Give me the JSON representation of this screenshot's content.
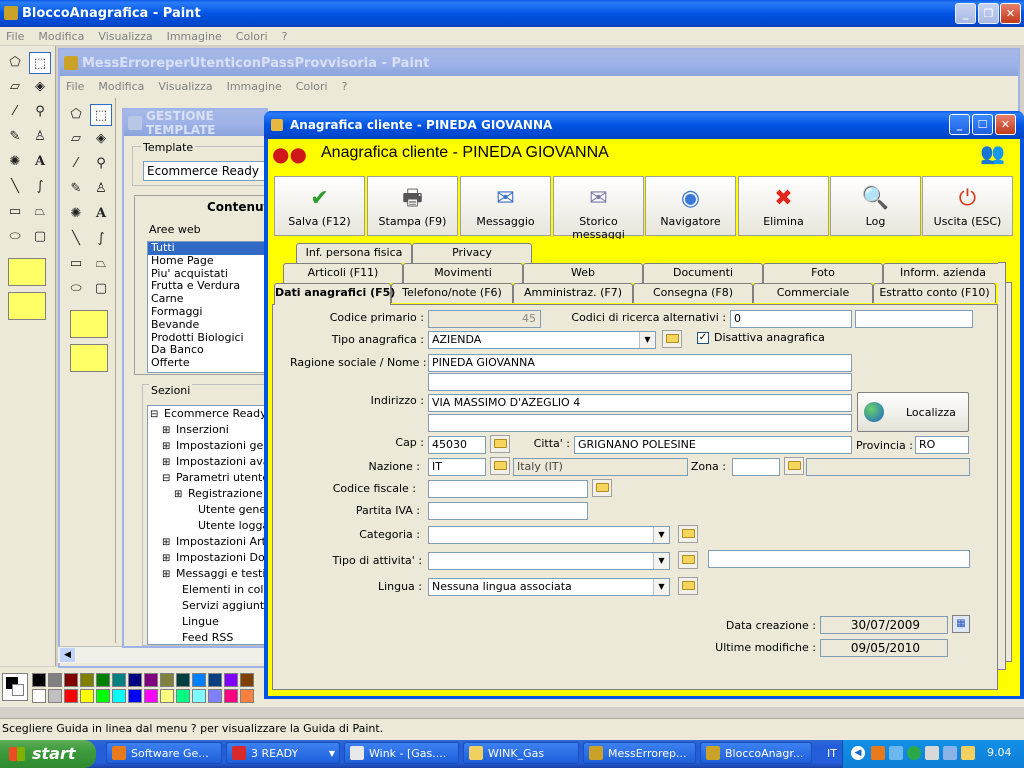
{
  "paint1": {
    "title": "BloccoAnagrafica - Paint",
    "menu": [
      "File",
      "Modifica",
      "Visualizza",
      "Immagine",
      "Colori",
      "?"
    ],
    "status": "Scegliere Guida in linea dal menu ? per visualizzare la Guida di Paint."
  },
  "paint2": {
    "title": "MessErroreperUtenticonPassProvvisoria - Paint",
    "menu": [
      "File",
      "Modifica",
      "Visualizza",
      "Immagine",
      "Colori",
      "?"
    ]
  },
  "gestione": {
    "title": "GESTIONE TEMPLATE",
    "template_label": "Template",
    "template_value": "Ecommerce Ready Pro",
    "contenuti_label": "Contenuti",
    "aree_label": "Aree web",
    "aree": [
      "Tutti",
      "Home Page",
      "Piu' acquistati",
      "Frutta e Verdura",
      "Carne",
      "Formaggi",
      "Bevande",
      "Prodotti Biologici",
      "Da Banco",
      "Offerte"
    ],
    "sezioni_label": "Sezioni",
    "tree": [
      {
        "t": "Ecommerce Ready P",
        "sign": "⊟"
      },
      {
        "t": "Inserzioni",
        "sign": "⊞"
      },
      {
        "t": "Impostazioni gene",
        "sign": "⊞"
      },
      {
        "t": "Impostazioni avar",
        "sign": "⊞"
      },
      {
        "t": "Parametri utente",
        "sign": "⊟"
      },
      {
        "t": "Registrazione",
        "sign": "⊞"
      },
      {
        "t": "Utente generi",
        "sign": ""
      },
      {
        "t": "Utente loggat",
        "sign": ""
      },
      {
        "t": "Impostazioni Artic",
        "sign": "⊞"
      },
      {
        "t": "Impostazioni Doc",
        "sign": "⊞"
      },
      {
        "t": "Messaggi e testi",
        "sign": "⊞"
      },
      {
        "t": "Elementi in colon",
        "sign": ""
      },
      {
        "t": "Servizi aggiuntivi",
        "sign": ""
      },
      {
        "t": "Lingue",
        "sign": ""
      },
      {
        "t": "Feed RSS",
        "sign": ""
      }
    ]
  },
  "dialog": {
    "title": "Anagrafica cliente - PINEDA GIOVANNA",
    "header": "Anagrafica cliente - PINEDA GIOVANNA",
    "toolbar": [
      {
        "label": "Salva (F12)",
        "icon": "check-icon",
        "glyph": "✔",
        "color": "#2a9d2a"
      },
      {
        "label": "Stampa (F9)",
        "icon": "printer-icon",
        "glyph": "🖶",
        "color": "#555555"
      },
      {
        "label": "Messaggio",
        "icon": "message-icon",
        "glyph": "✉",
        "color": "#3a6fc4"
      },
      {
        "label": "Storico messaggi",
        "icon": "message-history-icon",
        "glyph": "✉",
        "color": "#7a7aa8"
      },
      {
        "label": "Navigatore",
        "icon": "navigator-icon",
        "glyph": "◉",
        "color": "#3a78d8"
      },
      {
        "label": "Elimina",
        "icon": "delete-icon",
        "glyph": "✖",
        "color": "#e0281c"
      },
      {
        "label": "Log",
        "icon": "log-icon",
        "glyph": "🔍",
        "color": "#2a60c0"
      },
      {
        "label": "Uscita (ESC)",
        "icon": "exit-icon",
        "glyph": "⏻",
        "color": "#d8361c"
      }
    ],
    "tabs_row1": [
      "Inf. persona fisica",
      "Privacy"
    ],
    "tabs_row2": [
      "Articoli (F11)",
      "Movimenti",
      "Web",
      "Documenti",
      "Foto",
      "Inform. azienda"
    ],
    "tabs_row3": [
      "Dati anagrafici (F5)",
      "Telefono/note (F6)",
      "Amministraz. (F7)",
      "Consegna (F8)",
      "Commerciale",
      "Estratto conto (F10)"
    ],
    "form": {
      "codice_primario_label": "Codice primario :",
      "codice_primario": "45",
      "codici_alt_label": "Codici di ricerca alternativi :",
      "codice_alt1": "0",
      "codice_alt2": "",
      "tipo_label": "Tipo anagrafica :",
      "tipo": "AZIENDA",
      "disattiva_label": "Disattiva anagrafica",
      "ragione_label": "Ragione sociale / Nome :",
      "ragione1": "PINEDA GIOVANNA",
      "ragione2": "",
      "indirizzo_label": "Indirizzo :",
      "indirizzo1": "VIA MASSIMO D'AZEGLIO 4",
      "indirizzo2": "",
      "localizza": "Localizza",
      "cap_label": "Cap :",
      "cap": "45030",
      "citta_label": "Citta' :",
      "citta": "GRIGNANO POLESINE",
      "provincia_label": "Provincia :",
      "provincia": "RO",
      "nazione_label": "Nazione :",
      "nazione": "IT",
      "nazione_desc": "Italy (IT)",
      "zona_label": "Zona :",
      "zona": "",
      "zona_desc": "",
      "cf_label": "Codice fiscale :",
      "cf": "",
      "piva_label": "Partita IVA :",
      "piva": "",
      "categoria_label": "Categoria :",
      "categoria": "",
      "attivita_label": "Tipo di attivita' :",
      "attivita": "",
      "attivita_extra": "",
      "lingua_label": "Lingua :",
      "lingua": "Nessuna lingua associata",
      "data_creazione_label": "Data creazione :",
      "data_creazione": "30/07/2009",
      "ultime_modifiche_label": "Ultime modifiche :",
      "ultime_modifiche": "09/05/2010"
    }
  },
  "taskbar": {
    "start": "start",
    "items": [
      "Software Ge...",
      "3 READY",
      "Wink - [Gas....",
      "WINK_Gas",
      "MessErrorep...",
      "BloccoAnagr..."
    ],
    "lang": "IT",
    "clock": "9.04"
  },
  "colors": {
    "accent": "#0054e3",
    "header_yellow": "#ffff00",
    "taskbar": "#245edb",
    "start": "#3c9a3c"
  }
}
